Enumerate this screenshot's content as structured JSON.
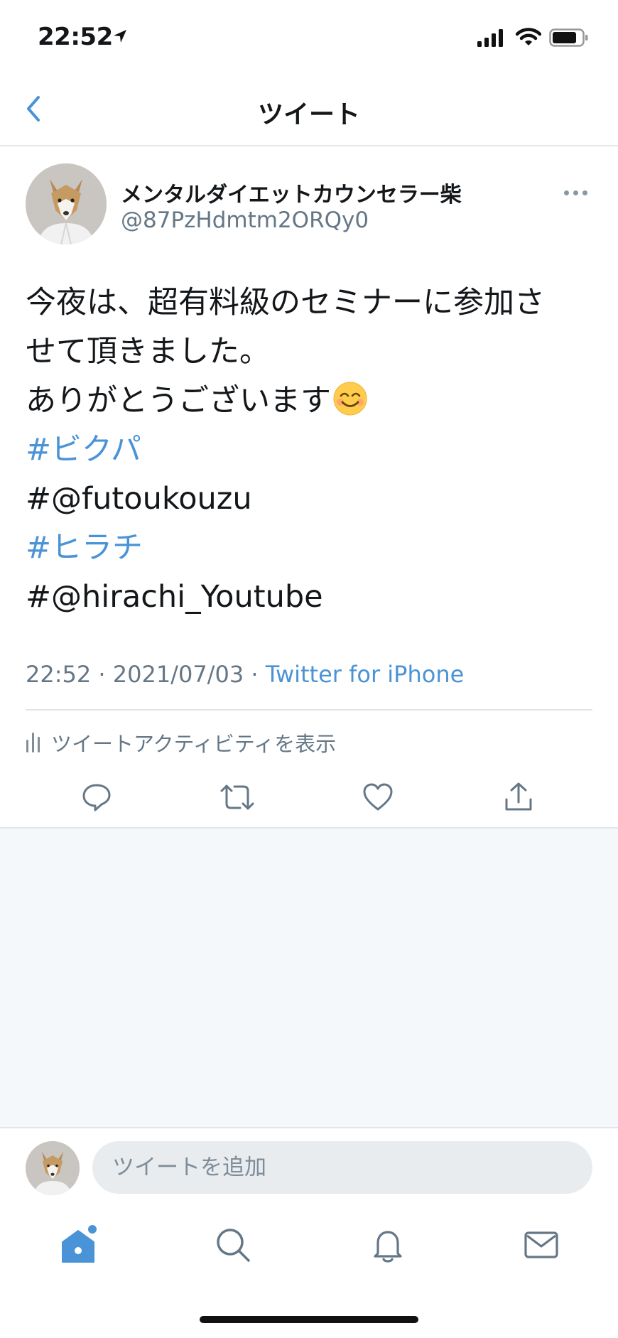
{
  "status_bar": {
    "time": "22:52"
  },
  "nav": {
    "title": "ツイート"
  },
  "tweet": {
    "author": {
      "name": "メンタルダイエットカウンセラー柴",
      "handle": "@87PzHdmtm2ORQy0"
    },
    "lines": [
      {
        "text": "今夜は、超有料級のセミナーに参加さ",
        "is_hashtag": false
      },
      {
        "text": "せて頂きました。",
        "is_hashtag": false
      },
      {
        "text": "ありがとうございます",
        "is_hashtag": false
      },
      {
        "text": "#ビクパ",
        "is_hashtag": true
      },
      {
        "text": "#@futoukouzu",
        "is_hashtag": false
      },
      {
        "text": "#ヒラチ",
        "is_hashtag": true
      },
      {
        "text": "#@hirachi_Youtube",
        "is_hashtag": false
      }
    ],
    "emoji": "smiling-face-emoji",
    "time": "22:52",
    "separator": " · ",
    "date": "2021/07/03",
    "source": "Twitter for iPhone",
    "activity_label": "ツイートアクティビティを表示"
  },
  "reply": {
    "placeholder": "ツイートを追加"
  },
  "icons": {
    "back": "chevron-left-icon",
    "more": "ellipsis-icon",
    "activity": "bar-chart-icon",
    "reply": "reply-icon",
    "retweet": "retweet-icon",
    "like": "heart-icon",
    "share": "share-icon",
    "tabs": [
      "home-icon",
      "search-icon",
      "bell-icon",
      "mail-icon"
    ]
  },
  "colors": {
    "accent": "#4a93d6",
    "secondary_text": "#657786",
    "divider": "#e3e6e9",
    "background_empty": "#f5f8fa"
  }
}
